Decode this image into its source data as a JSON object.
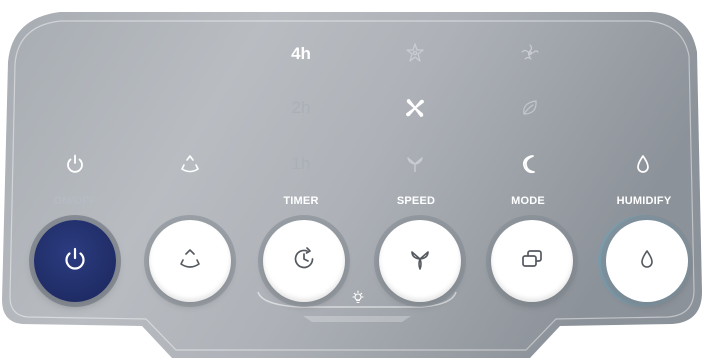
{
  "colors": {
    "panel_light": "#b3b7bd",
    "panel_dark": "#8e949b",
    "power_button": "#1f2c66",
    "label_active": "#ffffff",
    "label_inactive": "#b6bac2"
  },
  "timer_levels": [
    "4h",
    "2h",
    "1h"
  ],
  "timer_selected": "4h",
  "speed_levels": [
    "high-speed-icon",
    "medium-speed-icon",
    "low-speed-icon"
  ],
  "speed_selected": "medium-speed-icon",
  "mode_levels": [
    "natural-wind-icon",
    "eco-leaf-icon",
    "sleep-moon-icon"
  ],
  "mode_selected": "sleep-moon-icon",
  "buttons": [
    {
      "label": "ON/OFF",
      "icon": "power-icon",
      "pressed": true
    },
    {
      "label": "OSC",
      "icon": "oscillate-icon",
      "pressed": false
    },
    {
      "label": "TIMER",
      "icon": "timer-icon",
      "pressed": false
    },
    {
      "label": "SPEED",
      "icon": "fan-speed-icon",
      "pressed": false
    },
    {
      "label": "MODE",
      "icon": "mode-windows-icon",
      "pressed": false
    },
    {
      "label": "HUMIDIFY",
      "icon": "water-drop-icon",
      "pressed": false
    }
  ],
  "indicators": {
    "power": "power-icon",
    "osc": "oscillate-icon",
    "humidify": "water-drop-icon",
    "light": "light-bulb-icon"
  }
}
